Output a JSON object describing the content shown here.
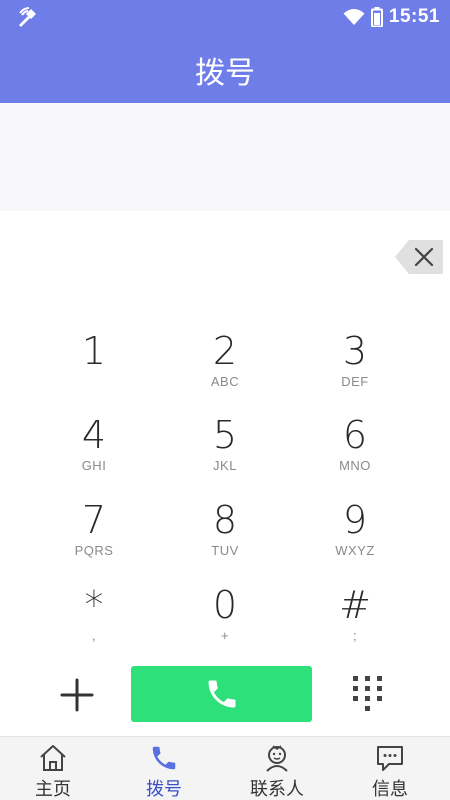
{
  "status_bar": {
    "time": "15:51",
    "left_icon": "broadcast-icon",
    "right_icons": [
      "wifi-icon",
      "battery-icon"
    ]
  },
  "header": {
    "title": "拨号"
  },
  "number_display": {
    "value": ""
  },
  "keypad": {
    "keys": [
      {
        "digit": "1",
        "letters": ""
      },
      {
        "digit": "2",
        "letters": "ABC"
      },
      {
        "digit": "3",
        "letters": "DEF"
      },
      {
        "digit": "4",
        "letters": "GHI"
      },
      {
        "digit": "5",
        "letters": "JKL"
      },
      {
        "digit": "6",
        "letters": "MNO"
      },
      {
        "digit": "7",
        "letters": "PQRS"
      },
      {
        "digit": "8",
        "letters": "TUV"
      },
      {
        "digit": "9",
        "letters": "WXYZ"
      },
      {
        "digit": "*",
        "letters": ","
      },
      {
        "digit": "0",
        "letters": "+"
      },
      {
        "digit": "#",
        "letters": ";"
      }
    ]
  },
  "actions": {
    "add_icon": "plus-icon",
    "call_icon": "phone-icon",
    "keypad_icon": "dialpad-icon",
    "backspace_icon": "backspace-icon"
  },
  "bottom_nav": {
    "items": [
      {
        "label": "主页",
        "icon": "home-icon",
        "active": false
      },
      {
        "label": "拨号",
        "icon": "phone-icon",
        "active": true
      },
      {
        "label": "联系人",
        "icon": "contact-icon",
        "active": false
      },
      {
        "label": "信息",
        "icon": "message-icon",
        "active": false
      }
    ]
  },
  "colors": {
    "header": "#6f7de8",
    "call_button": "#2ee07a",
    "active_nav": "#3b4fc7"
  }
}
